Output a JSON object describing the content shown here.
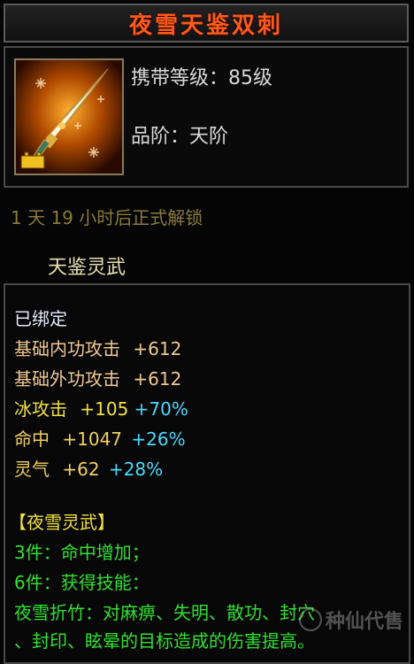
{
  "title": "夜雪天鉴双刺",
  "item": {
    "carry_level_label": "携带等级：85级",
    "rank_label": "品阶：天阶",
    "icon": "twin-dagger-icon"
  },
  "unlock_text": "1 天 19 小时后正式解锁",
  "subtitle": "天鉴灵武",
  "stats": {
    "bound": "已绑定",
    "base_inner_attack": {
      "label": "基础内功攻击",
      "value": "+612"
    },
    "base_outer_attack": {
      "label": "基础外功攻击",
      "value": "+612"
    },
    "ice_attack": {
      "label": "冰攻击",
      "value": "+105",
      "bonus": "+70%"
    },
    "accuracy": {
      "label": "命中",
      "value": "+1047",
      "bonus": "+26%"
    },
    "spirit": {
      "label": "灵气",
      "value": "+62",
      "bonus": "+28%"
    }
  },
  "set": {
    "name": "【夜雪灵武】",
    "bonus3": "3件：命中增加；",
    "bonus6": "6件：获得技能：",
    "skill_line1": "夜雪折竹：对麻痹、失明、散功、封穴",
    "skill_line2": "、封印、眩晕的目标造成的伤害提高。"
  },
  "watermark": "种仙代售",
  "colors": {
    "title": "#ff5a1a",
    "bound": "#e8e8ff",
    "base_stat": "#f0c890",
    "element_stat": "#f0e040",
    "bonus": "#4ad8ff",
    "set_text": "#30e030"
  }
}
